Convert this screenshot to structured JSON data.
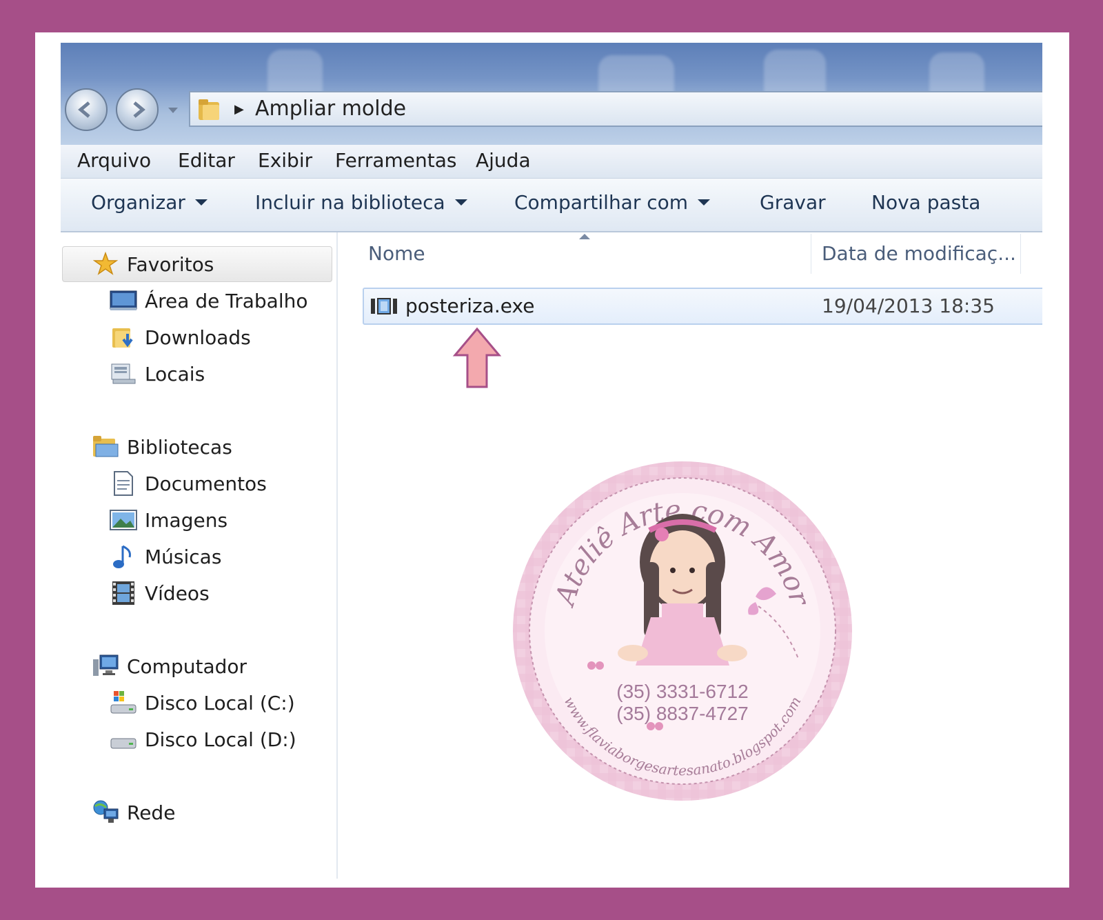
{
  "colors": {
    "frame": "#a64f88",
    "inner_bg": "#ffffff",
    "arrow_fill": "#f3a9ae",
    "arrow_stroke": "#a64f88",
    "seal_pink": "#f6d6e6"
  },
  "window": {
    "address": {
      "segments": [
        "Ampliar molde"
      ]
    },
    "menu": [
      "Arquivo",
      "Editar",
      "Exibir",
      "Ferramentas",
      "Ajuda"
    ],
    "toolbar": {
      "organize": "Organizar",
      "include_library": "Incluir na biblioteca",
      "share_with": "Compartilhar com",
      "burn": "Gravar",
      "new_folder": "Nova pasta"
    }
  },
  "sidebar": {
    "favorites": {
      "label": "Favoritos",
      "items": [
        "Área de Trabalho",
        "Downloads",
        "Locais"
      ]
    },
    "libraries": {
      "label": "Bibliotecas",
      "items": [
        "Documentos",
        "Imagens",
        "Músicas",
        "Vídeos"
      ]
    },
    "computer": {
      "label": "Computador",
      "items": [
        "Disco Local (C:)",
        "Disco Local (D:)"
      ]
    },
    "network": {
      "label": "Rede"
    }
  },
  "file_list": {
    "columns": [
      "Nome",
      "Data de modificaç..."
    ],
    "files": [
      {
        "name": "posteriza.exe",
        "modified": "19/04/2013 18:35",
        "icon": "exe-icon"
      }
    ]
  },
  "watermark": {
    "brand": "Ateliê Arte com Amor",
    "phones": [
      "(35) 3331-6712",
      "(35) 8837-4727"
    ],
    "url": "www.flaviaborgesartesanato.blogspot.com"
  }
}
